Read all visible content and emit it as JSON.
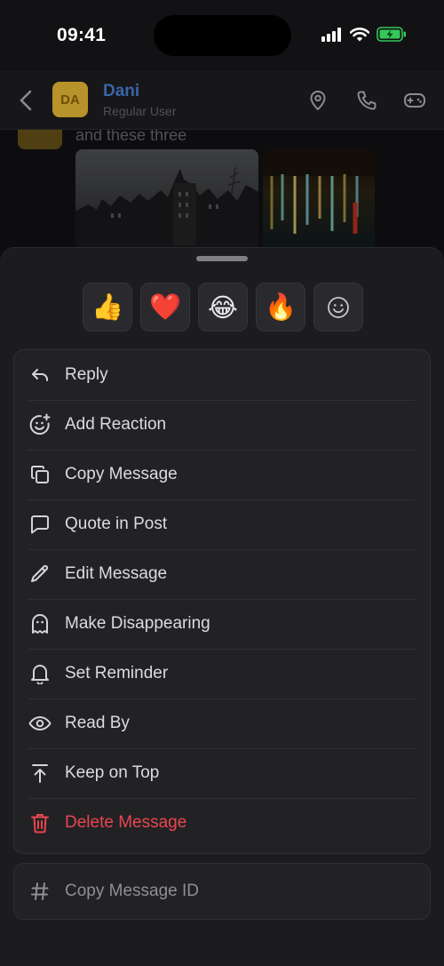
{
  "status_bar": {
    "time": "09:41"
  },
  "header": {
    "avatar_initials": "DA",
    "name": "Dani",
    "subtitle": "Regular User",
    "icons": [
      "back-icon",
      "location-pin-icon",
      "phone-icon",
      "gamepad-icon"
    ]
  },
  "chat": {
    "message_text": "and these three"
  },
  "reactions": [
    {
      "emoji": "👍",
      "name": "thumbs-up"
    },
    {
      "emoji": "❤️",
      "name": "heart"
    },
    {
      "emoji": "😂",
      "name": "tears-of-joy"
    },
    {
      "emoji": "🔥",
      "name": "fire"
    },
    {
      "name": "add-reaction-icon"
    }
  ],
  "menu": {
    "items": [
      {
        "label": "Reply",
        "icon": "reply-icon"
      },
      {
        "label": "Add Reaction",
        "icon": "smiley-plus-icon"
      },
      {
        "label": "Copy Message",
        "icon": "copy-icon"
      },
      {
        "label": "Quote in Post",
        "icon": "speech-bubble-icon"
      },
      {
        "label": "Edit Message",
        "icon": "pencil-icon"
      },
      {
        "label": "Make Disappearing",
        "icon": "ghost-icon"
      },
      {
        "label": "Set Reminder",
        "icon": "bell-icon"
      },
      {
        "label": "Read By",
        "icon": "eye-icon"
      },
      {
        "label": "Keep on Top",
        "icon": "pin-top-icon"
      },
      {
        "label": "Delete Message",
        "icon": "trash-icon"
      }
    ],
    "secondary": {
      "label": "Copy Message ID",
      "icon": "hash-icon"
    }
  },
  "colors": {
    "danger": "#e8464f",
    "name_accent": "#3b64a6",
    "battery": "#34c759"
  }
}
